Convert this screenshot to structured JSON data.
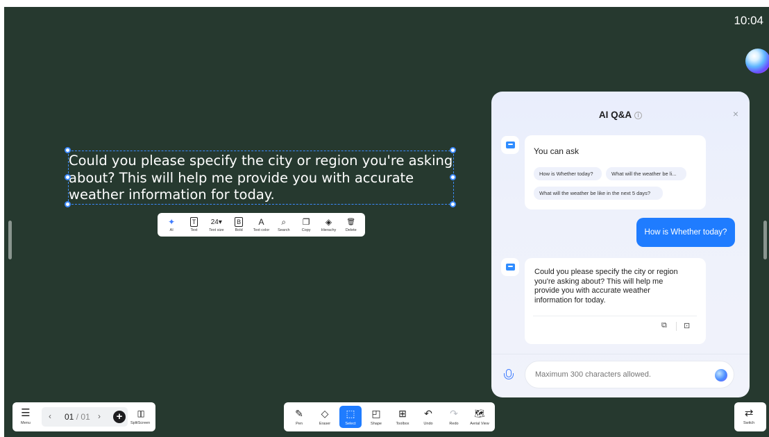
{
  "clock": "10:04",
  "text_box": {
    "content": "Could you please specify the city or region you're asking about? This will help me provide you with accurate weather information for today."
  },
  "text_toolbar": [
    {
      "icon": "ai-icon",
      "glyph": "✦",
      "label": "AI"
    },
    {
      "icon": "text-icon",
      "glyph": "T",
      "label": "Text"
    },
    {
      "icon": "text-size-icon",
      "glyph": "24▾",
      "label": "Text size"
    },
    {
      "icon": "bold-icon",
      "glyph": "B",
      "label": "Bold"
    },
    {
      "icon": "text-color-icon",
      "glyph": "A",
      "label": "Text color"
    },
    {
      "icon": "search-icon",
      "glyph": "⌕",
      "label": "Search"
    },
    {
      "icon": "copy-icon",
      "glyph": "❐",
      "label": "Copy"
    },
    {
      "icon": "hierarchy-icon",
      "glyph": "◈",
      "label": "Hierachy"
    },
    {
      "icon": "delete-icon",
      "glyph": "🗑",
      "label": "Delete"
    }
  ],
  "ai_panel": {
    "title": "AI Q&A",
    "info_glyph": "i",
    "close_glyph": "×",
    "intro_title": "You can ask",
    "suggestions": [
      "How is Whether today?",
      "What will the weather be li...",
      "What will the weather be like in the next 5 days?"
    ],
    "user_message": "How is Whether today?",
    "answer": "Could you please specify the city or region you're asking about? This will help me provide you with accurate weather information for today.",
    "answer_actions": [
      {
        "icon": "copy-icon",
        "glyph": "⧉"
      },
      {
        "icon": "insert-to-board-icon",
        "glyph": "⊡"
      }
    ],
    "input_placeholder": "Maximum 300 characters allowed."
  },
  "menu_bar": {
    "menu_label": "Menu",
    "menu_glyph": "☰",
    "prev_glyph": "‹",
    "next_glyph": "›",
    "current_page": "01",
    "page_separator": "/",
    "total_pages": "01",
    "add_glyph": "+",
    "split_label": "SplitScreen",
    "split_glyph": "▯▯"
  },
  "tools": [
    {
      "icon": "pen-icon",
      "glyph": "✎",
      "label": "Pen",
      "active": false
    },
    {
      "icon": "eraser-icon",
      "glyph": "◇",
      "label": "Eraser",
      "active": false
    },
    {
      "icon": "select-icon",
      "glyph": "⬚",
      "label": "Select",
      "active": true
    },
    {
      "icon": "shape-icon",
      "glyph": "◰",
      "label": "Shape",
      "active": false
    },
    {
      "icon": "toolbox-icon",
      "glyph": "⊞",
      "label": "Toolbox",
      "active": false
    },
    {
      "icon": "undo-icon",
      "glyph": "↶",
      "label": "Undo",
      "active": false
    },
    {
      "icon": "redo-icon",
      "glyph": "↷",
      "label": "Redo",
      "active": false,
      "disabled": true
    },
    {
      "icon": "aerial-view-icon",
      "glyph": "🗺",
      "label": "Aerial View",
      "active": false
    }
  ],
  "switch": {
    "glyph": "⇄",
    "label": "Switch"
  },
  "colors": {
    "board": "#26392f",
    "accent": "#1f7cff",
    "panel": "#eef1fb"
  }
}
